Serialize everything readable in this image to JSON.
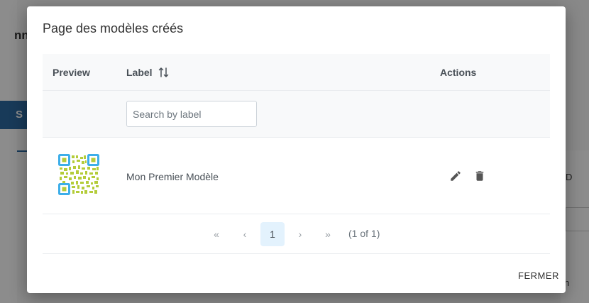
{
  "background": {
    "heading_fragment": "nn",
    "button_fragment": "S",
    "right_text_1": "D",
    "right_text_2": "h"
  },
  "dialog": {
    "title": "Page des modèles créés",
    "columns": {
      "preview": "Preview",
      "label": "Label",
      "actions": "Actions"
    },
    "search": {
      "placeholder": "Search by label",
      "value": ""
    },
    "rows": [
      {
        "label": "Mon Premier Modèle",
        "preview": "qr-code-thumbnail"
      }
    ],
    "paginator": {
      "first": "«",
      "prev": "‹",
      "current_page": "1",
      "next": "›",
      "last": "»",
      "report": "(1 of 1)"
    },
    "close_label": "FERMER"
  },
  "colors": {
    "qr_finder": "#3daee9",
    "qr_modules": "#b4cc3a",
    "active_page_bg": "#e3f2fd"
  },
  "icons": {
    "sort": "sort-alt-icon",
    "edit": "pencil-icon",
    "delete": "trash-icon"
  }
}
